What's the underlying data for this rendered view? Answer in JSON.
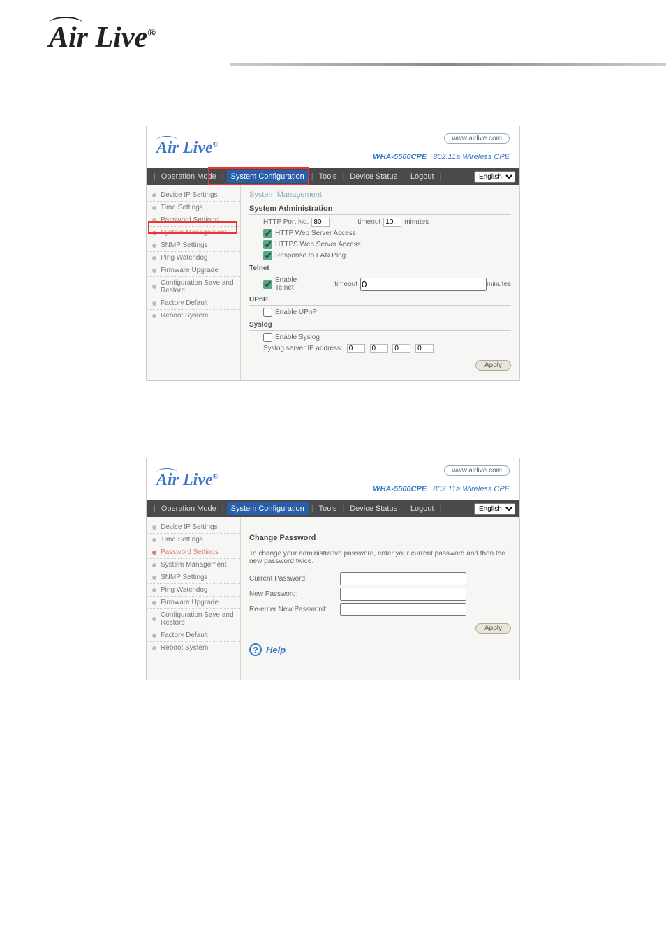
{
  "brand": {
    "name": "Air Live",
    "reg": "®"
  },
  "www_link": "www.airlive.com",
  "model": {
    "name": "WHA-5500CPE",
    "desc": "802.11a Wireless CPE"
  },
  "menu": {
    "operation_mode": "Operation Mode",
    "system_config": "System Configuration",
    "tools": "Tools",
    "device_status": "Device Status",
    "logout": "Logout",
    "language": "English"
  },
  "sidebar_items": [
    "Device IP Settings",
    "Time Settings",
    "Password Settings",
    "System Management",
    "SNMP Settings",
    "Ping Watchdog",
    "Firmware Upgrade",
    "Configuration Save and Restore",
    "Factory Default",
    "Reboot System"
  ],
  "panel1": {
    "title": "System Management",
    "sysadmin": {
      "heading": "System Administration",
      "http_port_label": "HTTP Port No.",
      "http_port_value": "80",
      "timeout_label": "timeout",
      "timeout_value": "10",
      "timeout_unit": "minutes",
      "http_access": "HTTP Web Server Access",
      "https_access": "HTTPS Web Server Access",
      "lan_ping": "Response to LAN Ping"
    },
    "telnet": {
      "heading": "Telnet",
      "enable": "Enable Telnet",
      "timeout_label": "timeout",
      "timeout_value": "0",
      "timeout_unit": "minutes"
    },
    "upnp": {
      "heading": "UPnP",
      "enable": "Enable UPnP"
    },
    "syslog": {
      "heading": "Syslog",
      "enable": "Enable Syslog",
      "server_label": "Syslog server IP address:",
      "ip": [
        "0",
        "0",
        "0",
        "0"
      ]
    },
    "apply": "Apply"
  },
  "panel2": {
    "heading": "Change Password",
    "instruction": "To change your administrative password, enter your current password and then the new password twice.",
    "current": "Current Password:",
    "newpw": "New Password:",
    "reenter": "Re-enter New Password:",
    "apply": "Apply",
    "help": "Help"
  }
}
